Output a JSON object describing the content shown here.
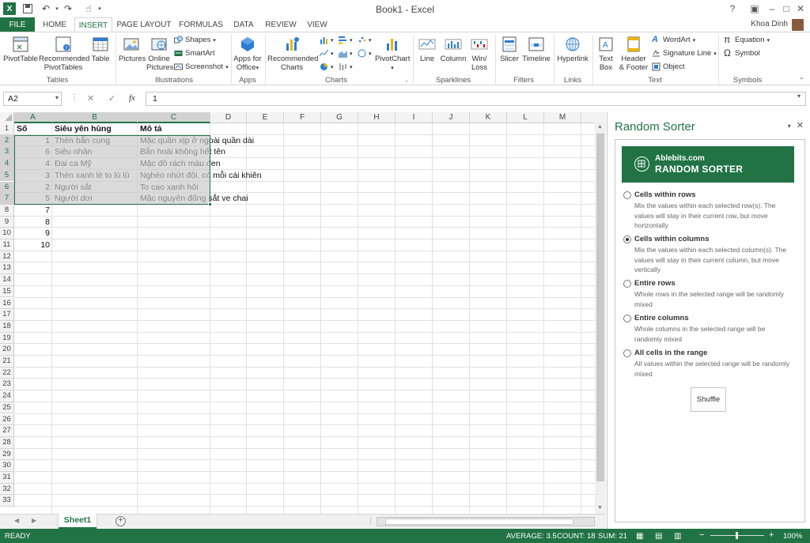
{
  "window": {
    "title": "Book1 - Excel",
    "user": "Khoa Dinh"
  },
  "tabs": [
    "FILE",
    "HOME",
    "INSERT",
    "PAGE LAYOUT",
    "FORMULAS",
    "DATA",
    "REVIEW",
    "VIEW"
  ],
  "ribbon": {
    "pivottable": "PivotTable",
    "rec_pivot_1": "Recommended",
    "rec_pivot_2": "PivotTables",
    "table": "Table",
    "grp_tables": "Tables",
    "pictures": "Pictures",
    "online_1": "Online",
    "online_2": "Pictures",
    "shapes": "Shapes",
    "smartart": "SmartArt",
    "screenshot": "Screenshot",
    "grp_illustrations": "Illustrations",
    "apps_1": "Apps for",
    "apps_2": "Office",
    "grp_apps": "Apps",
    "rec_charts_1": "Recommended",
    "rec_charts_2": "Charts",
    "pivotchart": "PivotChart",
    "grp_charts": "Charts",
    "line": "Line",
    "column": "Column",
    "winloss_1": "Win/",
    "winloss_2": "Loss",
    "grp_sparklines": "Sparklines",
    "slicer": "Slicer",
    "timeline": "Timeline",
    "grp_filters": "Filters",
    "hyperlink": "Hyperlink",
    "grp_links": "Links",
    "textbox_1": "Text",
    "textbox_2": "Box",
    "header_1": "Header",
    "header_2": "& Footer",
    "wordart": "WordArt",
    "sigline": "Signature Line",
    "object": "Object",
    "grp_text": "Text",
    "equation": "Equation",
    "symbol": "Symbol",
    "grp_symbols": "Symbols"
  },
  "formula_bar": {
    "name_box": "A2",
    "fx": "fx",
    "value": "1"
  },
  "columns": [
    "A",
    "B",
    "C",
    "D",
    "E",
    "F",
    "G",
    "H",
    "I",
    "J",
    "K",
    "L",
    "M"
  ],
  "rows": [
    "1",
    "2",
    "3",
    "4",
    "5",
    "6",
    "7",
    "8",
    "9",
    "10",
    "11",
    "12",
    "13",
    "14",
    "15",
    "16",
    "17",
    "18",
    "19",
    "20",
    "21",
    "22",
    "23",
    "24",
    "25",
    "26",
    "27",
    "28",
    "29",
    "30",
    "31",
    "32",
    "33"
  ],
  "sheet": {
    "headers": [
      "Số",
      "Siêu yên hùng",
      "Mô tả"
    ],
    "data": [
      [
        "1",
        "Thèn bắn cung",
        "Mặc quần xịp ở ngoài quần dài"
      ],
      [
        "6",
        "Siêu nhân",
        "Bắn hoài không hết tên"
      ],
      [
        "4",
        "Đại ca Mỹ",
        "Mặc đồ rách màu đen"
      ],
      [
        "3",
        "Thèn xanh lè to lù lù",
        "Nghèo nhứt đội, có mỗi cái khiên"
      ],
      [
        "2",
        "Người sắt",
        "To cao xanh hôi"
      ],
      [
        "5",
        "Người dơi",
        "Mặc nguyên đống sắt ve chai"
      ]
    ],
    "extra_a": [
      "7",
      "8",
      "9",
      "10"
    ]
  },
  "sheet_tab": "Sheet1",
  "pane": {
    "title": "Random Sorter",
    "brand": "Ablebits.com",
    "product": "RANDOM SORTER",
    "options": [
      {
        "title": "Cells within rows",
        "desc": "Mix the values within each selected row(s). The values will stay in their current row, but move horizontally",
        "checked": false
      },
      {
        "title": "Cells within columns",
        "desc": "Mix the values within each selected column(s). The values will stay in their current column, but move vertically",
        "checked": true
      },
      {
        "title": "Entire rows",
        "desc": "Whole rows in the selected range will be randomly mixed",
        "checked": false
      },
      {
        "title": "Entire columns",
        "desc": "Whole columns in the selected range will be randomly mixed",
        "checked": false
      },
      {
        "title": "All cells in the range",
        "desc": "All values within the selected range will be randomly mixed",
        "checked": false
      }
    ],
    "shuffle": "Shuffle"
  },
  "status": {
    "ready": "READY",
    "average": "AVERAGE: 3.5",
    "count": "COUNT: 18",
    "sum": "SUM: 21",
    "zoom": "100%"
  },
  "colors": {
    "accent": "#217346"
  }
}
